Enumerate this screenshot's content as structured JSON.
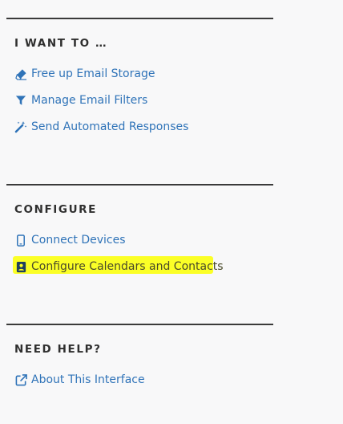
{
  "sections": [
    {
      "heading": "I WANT TO …",
      "links": [
        {
          "label": "Free up Email Storage",
          "icon": "eraser-icon"
        },
        {
          "label": "Manage Email Filters",
          "icon": "filter-icon"
        },
        {
          "label": "Send Automated Responses",
          "icon": "magic-wand-icon"
        }
      ]
    },
    {
      "heading": "CONFIGURE",
      "links": [
        {
          "label": "Connect Devices",
          "icon": "mobile-phone-icon"
        },
        {
          "label": "Configure Calendars and Contacts",
          "icon": "address-book-icon"
        }
      ]
    },
    {
      "heading": "NEED HELP?",
      "links": [
        {
          "label": "About This Interface",
          "icon": "external-link-icon"
        }
      ]
    }
  ],
  "colors": {
    "link": "#2f73b8",
    "heading": "#2f2f2f",
    "divider": "#3a3a3a",
    "highlight": "#fbff27",
    "background": "#f8f8f9"
  }
}
